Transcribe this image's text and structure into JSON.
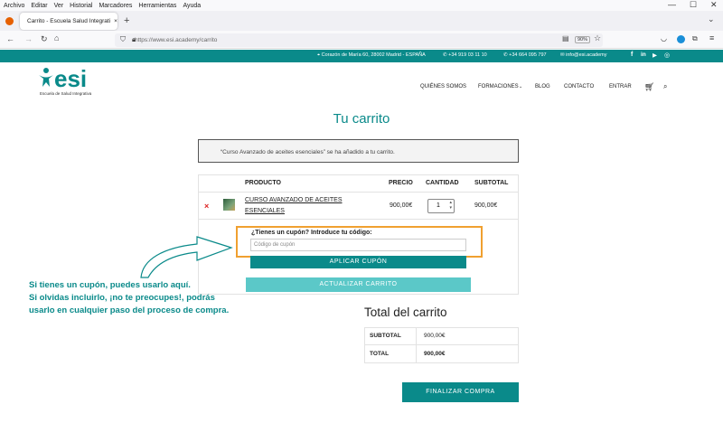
{
  "browser": {
    "menu": [
      "Archivo",
      "Editar",
      "Ver",
      "Historial",
      "Marcadores",
      "Herramientas",
      "Ayuda"
    ],
    "tab_title": "Carrito - Escuela Salud Integrati",
    "tab_close": "×",
    "new_tab": "+",
    "url": "https://www.esi.academy/carrito",
    "zoom": "90%"
  },
  "topbar": {
    "address": "Corazón de María 60, 28002 Madrid - ESPAÑA",
    "phone1": "+34 919 03 11 10",
    "phone2": "+34 664 095 797",
    "email": "info@esi.academy",
    "social": [
      "f",
      "in",
      "▶",
      "◎"
    ]
  },
  "logo": {
    "text": "esi",
    "subtitle": "Escuela de Salud Integrativa"
  },
  "nav": {
    "quienes": "QUIÉNES SOMOS",
    "formaciones": "FORMACIONES",
    "blog": "BLOG",
    "contacto": "CONTACTO",
    "entrar": "ENTRAR"
  },
  "page": {
    "title": "Tu carrito",
    "notice": "“Curso Avanzado de aceites esenciales” se ha añadido a tu carrito."
  },
  "cart": {
    "headers": {
      "producto": "PRODUCTO",
      "precio": "PRECIO",
      "cantidad": "CANTIDAD",
      "subtotal": "SUBTOTAL"
    },
    "item": {
      "remove": "×",
      "name_line1": "CURSO AVANZADO DE ACEITES",
      "name_line2": "ESENCIALES",
      "price": "900,00€",
      "quantity": "1",
      "subtotal": "900,00€"
    },
    "coupon": {
      "label": "¿Tienes un cupón? Introduce tu código:",
      "placeholder": "Código de cupón",
      "apply": "APLICAR CUPÓN"
    },
    "update": "ACTUALIZAR CARRITO"
  },
  "annotation": {
    "line1": "Si tienes un cupón, puedes usarlo aquí.",
    "line2": "Si olvidas incluirlo, ¡no te preocupes!, podrás",
    "line3": "usarlo en cualquier paso del proceso de compra."
  },
  "totals": {
    "title": "Total del carrito",
    "subtotal_label": "SUBTOTAL",
    "subtotal_value": "900,00€",
    "total_label": "TOTAL",
    "total_value": "900,00€",
    "checkout": "FINALIZAR COMPRA"
  },
  "colors": {
    "brand": "#0a8a8a",
    "highlight": "#f0a030",
    "light_button": "#5bc8c8"
  }
}
